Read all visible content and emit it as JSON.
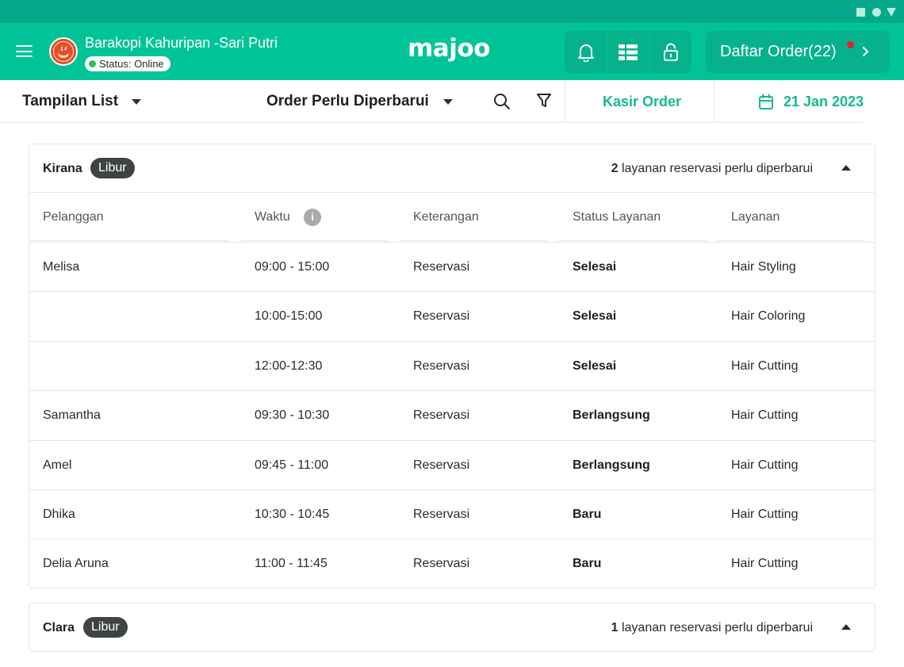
{
  "store": {
    "name": "Barakopi Kahuripan -Sari Putri",
    "status": "Status: Online"
  },
  "logo": "majoo",
  "header": {
    "order_button": "Daftar Order(22)"
  },
  "toolbar": {
    "view": "Tampilan List",
    "filter": "Order Perlu Diperbarui",
    "kasir": "Kasir Order",
    "date": "21 Jan 2023"
  },
  "colors": {
    "brand": "#00c498",
    "brand_dark": "#04a98a",
    "accent_text": "#17b98f",
    "badge": "#3f4443",
    "notification_dot": "#e8202a"
  },
  "icons": [
    "menu-icon",
    "bell-icon",
    "grid-icon",
    "unlock-icon",
    "chevron-right-icon",
    "search-icon",
    "filter-icon",
    "calendar-icon",
    "info-icon",
    "caret-up-icon",
    "caret-down-icon"
  ],
  "columns": [
    "Pelanggan",
    "Waktu",
    "Keterangan",
    "Status Layanan",
    "Layanan"
  ],
  "panels": [
    {
      "name": "Kirana",
      "badge": "Libur",
      "count": "2",
      "count_text": "layanan reservasi perlu diperbarui",
      "rows": [
        {
          "pelanggan": "Melisa",
          "waktu": "09:00 - 15:00",
          "keterangan": "Reservasi",
          "status": "Selesai",
          "layanan": "Hair Styling"
        },
        {
          "pelanggan": "",
          "waktu": "10:00-15:00",
          "keterangan": "Reservasi",
          "status": "Selesai",
          "layanan": "Hair Coloring"
        },
        {
          "pelanggan": "",
          "waktu": "12:00-12:30",
          "keterangan": "Reservasi",
          "status": "Selesai",
          "layanan": "Hair Cutting"
        },
        {
          "pelanggan": "Samantha",
          "waktu": "09:30 - 10:30",
          "keterangan": "Reservasi",
          "status": "Berlangsung",
          "layanan": "Hair Cutting"
        },
        {
          "pelanggan": "Amel",
          "waktu": "09:45 - 11:00",
          "keterangan": "Reservasi",
          "status": "Berlangsung",
          "layanan": "Hair Cutting"
        },
        {
          "pelanggan": "Dhika",
          "waktu": "10:30 - 10:45",
          "keterangan": "Reservasi",
          "status": "Baru",
          "layanan": "Hair Cutting"
        },
        {
          "pelanggan": "Delia Aruna",
          "waktu": "11:00 - 11:45",
          "keterangan": "Reservasi",
          "status": "Baru",
          "layanan": "Hair Cutting"
        }
      ]
    },
    {
      "name": "Clara",
      "badge": "Libur",
      "count": "1",
      "count_text": "layanan reservasi perlu diperbarui",
      "rows": []
    }
  ]
}
